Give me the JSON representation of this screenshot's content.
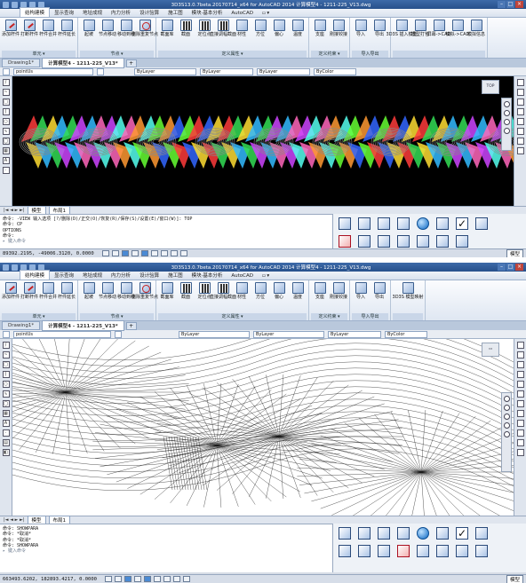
{
  "shots": [
    {
      "window_title": "3D3S13.0.7beta.20170714_x64 for AutoCAD 2014   计算模型4 - 1211-225_V13.dwg",
      "ribbon_tabs": [
        "结构建模",
        "显示查询",
        "地址成规",
        "内力分析",
        "设计验算",
        "施工图",
        "模块·基本分析",
        "AutoCAD",
        "▫ ▾"
      ],
      "panels": [
        {
          "name": "单元 ▾",
          "tools": [
            "添加杆件",
            "打断杆件",
            "杆件合并",
            "杆件延长"
          ]
        },
        {
          "name": "节点 ▾",
          "tools": [
            "起坡",
            "节点移动",
            "移动到线",
            "删除重复节点"
          ]
        },
        {
          "name": "定义属性 ▾",
          "tools": [
            "截面库",
            "截面",
            "定位点",
            "直接调幅截面",
            "材性",
            "方位",
            "偏心",
            "温度"
          ]
        },
        {
          "name": "定义约束 ▾",
          "tools": [
            "支座",
            "刚接铰接"
          ]
        },
        {
          "name": "导入导出",
          "tools": [
            "导入",
            "导出"
          ]
        },
        {
          "name": "",
          "tools": [
            "3D3S 插入模型",
            "模型打包",
            "屏幕->CAD",
            "模拟->CAD",
            "模拟信息"
          ]
        }
      ],
      "doc_tabs": [
        "Drawing1*",
        "计算模型4 - 1211-225_V13*"
      ],
      "layer_name": "pointUs",
      "color_value": "ByLayer",
      "linetype_value": "ByLayer",
      "lineweight_value": "ByLayer",
      "plot_style": "ByColor",
      "layout_tabs": [
        "模型",
        "布局1"
      ],
      "command_lines": [
        "命令: -VIEW 输入选项 [?/删除(D)/正交(O)/恢复(R)/保存(S)/设置(E)/窗口(W)]: TOP",
        "命令: CP",
        "OPTIONS",
        "命令:"
      ],
      "command_prompt": "键入命令",
      "coords": "89392.2195, -49006.3120, 0.0000",
      "model_label": "模型",
      "colors": {
        "viewport_bg": "#000000"
      }
    },
    {
      "window_title": "3D3S13.0.7beta.20170714_x64 for AutoCAD 2014   计算模型4 - 1211-225_V13.dwg",
      "ribbon_tabs": [
        "结构建模",
        "显示查询",
        "地址成规",
        "内力分析",
        "设计验算",
        "施工图",
        "模块·基本分析",
        "AutoCAD",
        "▫ ▾"
      ],
      "panels": [
        {
          "name": "单元 ▾",
          "tools": [
            "添加杆件",
            "打断杆件",
            "杆件合并",
            "杆件延长"
          ]
        },
        {
          "name": "节点 ▾",
          "tools": [
            "起坡",
            "节点移动",
            "移动到线",
            "删除重复节点"
          ]
        },
        {
          "name": "定义属性 ▾",
          "tools": [
            "截面库",
            "截面",
            "定位点",
            "直接调幅截面",
            "材性",
            "方位",
            "偏心",
            "温度"
          ]
        },
        {
          "name": "定义约束 ▾",
          "tools": [
            "支座",
            "刚接铰接"
          ]
        },
        {
          "name": "导入导出",
          "tools": [
            "导入",
            "导出"
          ]
        },
        {
          "name": "",
          "tools": [
            "3D3S 模型映射"
          ]
        }
      ],
      "doc_tabs": [
        "Drawing1*",
        "计算模型4 - 1211-225_V13*"
      ],
      "layer_name": "pointUs",
      "color_value": "ByLayer",
      "linetype_value": "ByLayer",
      "lineweight_value": "ByLayer",
      "plot_style": "ByColor",
      "layout_tabs": [
        "模型",
        "布局1"
      ],
      "command_lines": [
        "命令: SHOWPARA",
        "命令: *取消*",
        "命令: *取消*",
        "命令: SHOWPARA"
      ],
      "command_prompt": "键入命令",
      "coords": "663493.6202, 182893.4217, 0.0000",
      "model_label": "模型",
      "colors": {
        "viewport_bg": "#ffffff"
      }
    }
  ]
}
